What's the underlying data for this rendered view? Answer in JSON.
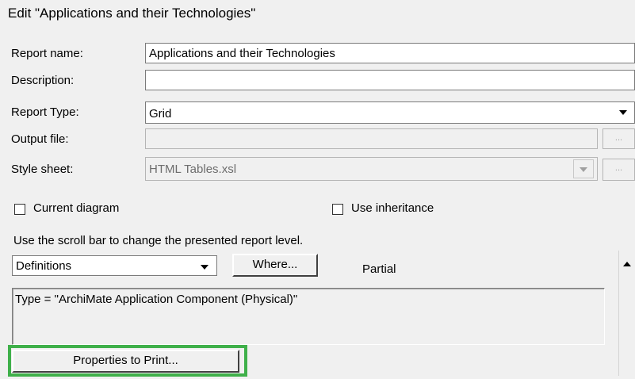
{
  "dialog": {
    "title": "Edit \"Applications and their Technologies\""
  },
  "form": {
    "report_name_label": "Report name:",
    "report_name_value": "Applications and their Technologies",
    "description_label": "Description:",
    "description_value": "",
    "report_type_label": "Report Type:",
    "report_type_value": "Grid",
    "output_file_label": "Output file:",
    "output_file_value": "",
    "style_sheet_label": "Style sheet:",
    "style_sheet_value": "HTML Tables.xsl",
    "browse_label": "..."
  },
  "options": {
    "current_diagram": "Current diagram",
    "current_diagram_checked": false,
    "use_inheritance": "Use inheritance",
    "use_inheritance_checked": false
  },
  "level": {
    "hint": "Use the scroll bar to change the presented report level.",
    "selected": "Definitions",
    "where_button": "Where...",
    "status": "Partial",
    "condition": "Type = \"ArchiMate Application Component (Physical)\""
  },
  "actions": {
    "properties_button": "Properties to Print...",
    "highlight_color": "#3fb04a"
  }
}
